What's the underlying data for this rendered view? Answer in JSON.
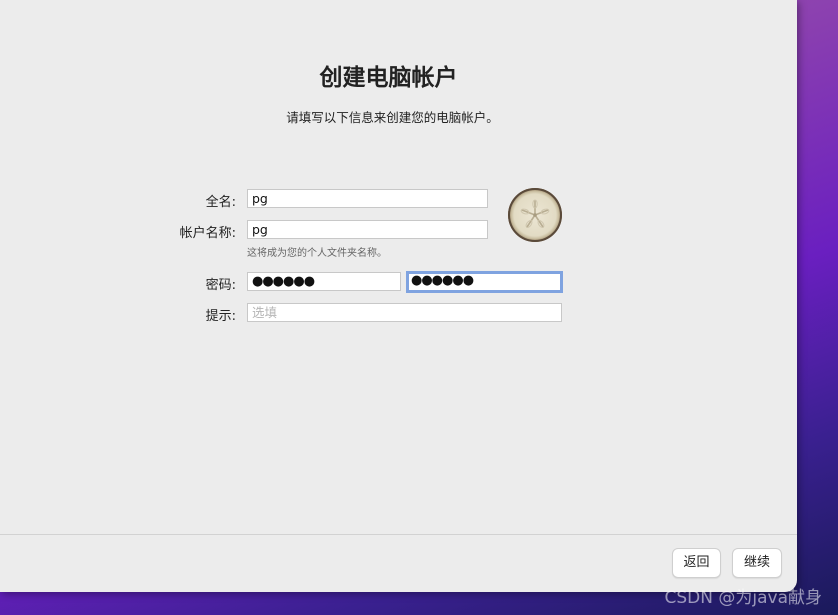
{
  "page": {
    "title": "创建电脑帐户",
    "subtitle": "请填写以下信息来创建您的电脑帐户。"
  },
  "form": {
    "full_name_label": "全名:",
    "full_name_value": "pg",
    "account_name_label": "帐户名称:",
    "account_name_value": "pg",
    "account_name_hint": "这将成为您的个人文件夹名称。",
    "password_label": "密码:",
    "password_value": "●●●●●●",
    "password_verify_value": "●●●●●●",
    "hint_label": "提示:",
    "hint_placeholder": "选填"
  },
  "avatar": {
    "icon": "sand-dollar-icon"
  },
  "footer": {
    "back_label": "返回",
    "continue_label": "继续"
  },
  "watermark": "CSDN @为java献身",
  "colors": {
    "focus_ring": "#7fa3e0",
    "window_bg": "#ececec"
  }
}
